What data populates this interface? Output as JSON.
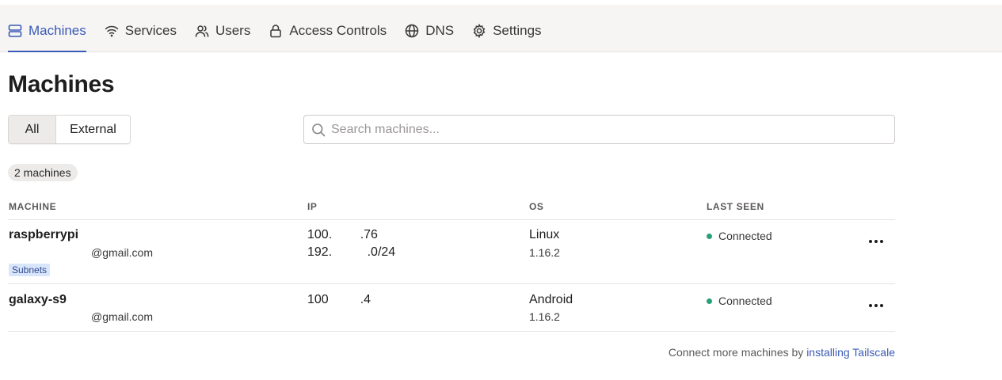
{
  "nav": {
    "tabs": [
      {
        "label": "Machines",
        "icon": "machines-icon",
        "active": true
      },
      {
        "label": "Services",
        "icon": "wifi-icon"
      },
      {
        "label": "Users",
        "icon": "users-icon"
      },
      {
        "label": "Access Controls",
        "icon": "lock-icon"
      },
      {
        "label": "DNS",
        "icon": "globe-icon"
      },
      {
        "label": "Settings",
        "icon": "gear-icon"
      }
    ]
  },
  "page": {
    "title": "Machines",
    "filters": {
      "all": "All",
      "external": "External",
      "selected": "All"
    },
    "search": {
      "placeholder": "Search machines...",
      "value": ""
    },
    "count": "2 machines"
  },
  "table": {
    "headers": {
      "machine": "MACHINE",
      "ip": "IP",
      "os": "OS",
      "last_seen": "LAST SEEN"
    },
    "rows": [
      {
        "name": "raspberrypi",
        "owner": "@gmail.com",
        "tag": "Subnets",
        "ip1": "100.        .76",
        "ip2": "192.          .0/24",
        "os": "Linux",
        "version": "1.16.2",
        "status": "Connected",
        "status_color": "#26a17b"
      },
      {
        "name": "galaxy-s9",
        "owner": "@gmail.com",
        "ip1": "100         .4",
        "os": "Android",
        "version": "1.16.2",
        "status": "Connected",
        "status_color": "#26a17b"
      }
    ]
  },
  "footer": {
    "text": "Connect more machines by ",
    "link": "installing Tailscale"
  },
  "colors": {
    "accent": "#3a5bb5",
    "connected": "#26a17b"
  }
}
